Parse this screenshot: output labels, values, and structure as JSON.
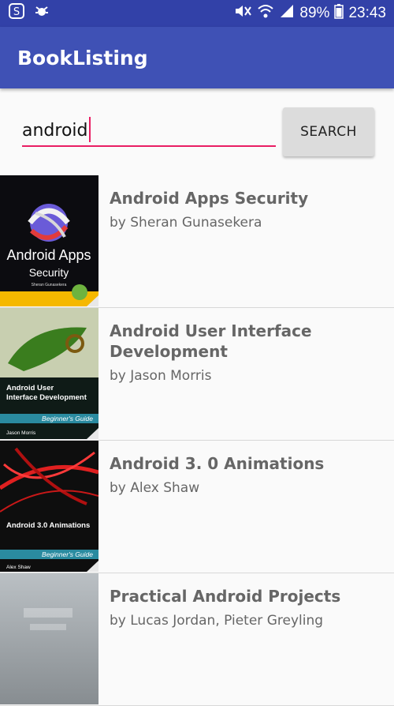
{
  "status": {
    "battery_percent": "89%",
    "time": "23:43",
    "icons_left": [
      "s-app-icon",
      "bug-icon"
    ],
    "icons_right": [
      "mute-icon",
      "wifi-icon",
      "signal-icon",
      "battery-icon"
    ]
  },
  "appbar": {
    "title": "BookListing"
  },
  "search": {
    "value": "android",
    "button_label": "SEARCH"
  },
  "books": [
    {
      "title": "Android Apps Security",
      "author": "by Sheran Gunasekera",
      "cover": {
        "text1": "Android Apps",
        "text2": "Security",
        "small": "Sheran Gunasekera"
      }
    },
    {
      "title": "Android User Interface Development",
      "author": "by Jason Morris",
      "cover": {
        "text1": "Android User",
        "text2": "Interface Development",
        "small": "Jason Morris",
        "guide": "Beginner's Guide"
      }
    },
    {
      "title": "Android 3. 0 Animations",
      "author": "by Alex Shaw",
      "cover": {
        "text1": "Android 3.0 Animations",
        "small": "Alex Shaw",
        "guide": "Beginner's Guide"
      }
    },
    {
      "title": "Practical Android Projects",
      "author": "by Lucas Jordan, Pieter Greyling",
      "cover": {}
    }
  ],
  "colors": {
    "primary": "#3f51b5",
    "status": "#3241a8",
    "accent": "#e91e63"
  }
}
